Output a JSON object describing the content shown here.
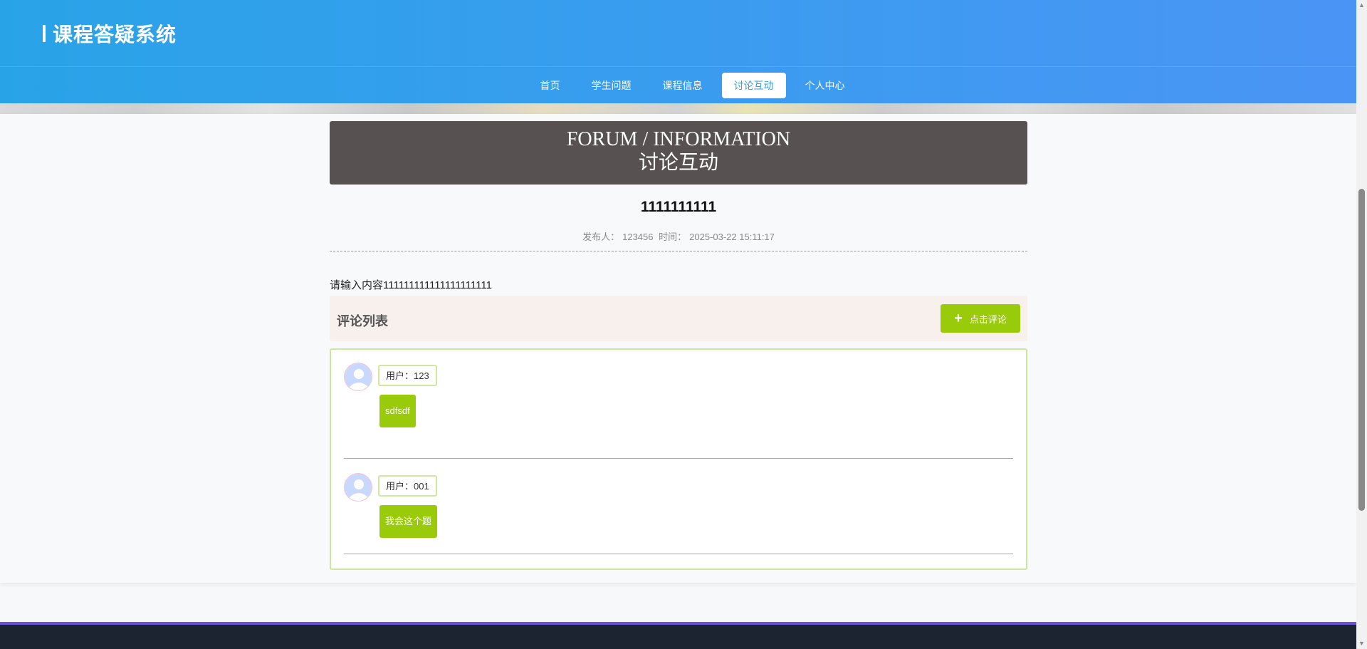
{
  "header": {
    "brand_title": "课程答疑系统",
    "nav": [
      {
        "label": "首页",
        "active": false
      },
      {
        "label": "学生问题",
        "active": false
      },
      {
        "label": "课程信息",
        "active": false
      },
      {
        "label": "讨论互动",
        "active": true
      },
      {
        "label": "个人中心",
        "active": false
      }
    ]
  },
  "section_banner": {
    "title_en": "FORUM / INFORMATION",
    "title_cn": "讨论互动"
  },
  "post": {
    "title": "1111111111",
    "author_label": "发布人：",
    "author": "123456",
    "time_label": "时间：",
    "time": "2025-03-22 15:11:17",
    "body": "请输入内容111111111111111111111"
  },
  "comments": {
    "section_title": "评论列表",
    "add_button_label": "点击评论",
    "items": [
      {
        "user": "用户：123",
        "text": "sdfsdf"
      },
      {
        "user": "用户：001",
        "text": "我会这个题"
      }
    ]
  },
  "colors": {
    "header_start": "#29a3e8",
    "header_end": "#4a94f5",
    "accent_green": "#9acb0a",
    "banner_box": "#575152"
  }
}
